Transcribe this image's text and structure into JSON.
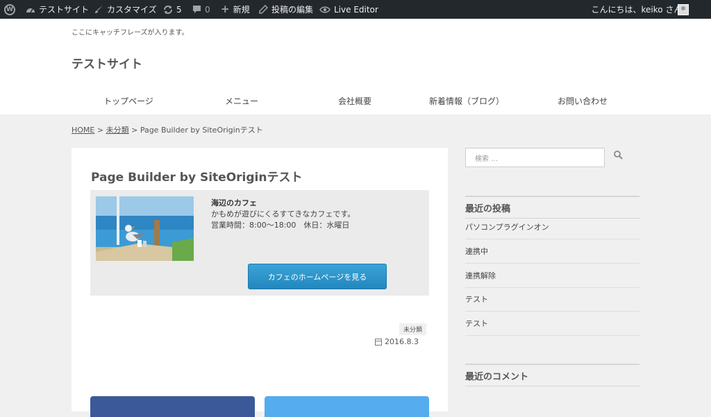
{
  "admin_bar": {
    "wp_logo": "wordpress-icon",
    "site_name": "テストサイト",
    "customize": "カスタマイズ",
    "updates_count": "5",
    "comments_count": "0",
    "new_label": "新規",
    "edit_post": "投稿の編集",
    "live_editor": "Live Editor",
    "greeting": "こんにちは、keiko さん !"
  },
  "header": {
    "tagline": "ここにキャッチフレーズが入ります。",
    "site_title": "テストサイト"
  },
  "nav": {
    "items": [
      "トップページ",
      "メニュー",
      "会社概要",
      "新着情報（ブログ）",
      "お問い合わせ"
    ]
  },
  "breadcrumb": {
    "home": "HOME",
    "sep": ">",
    "category": "未分類",
    "current": "Page Builder by SiteOriginテスト"
  },
  "article": {
    "title": "Page Builder by SiteOriginテスト",
    "widget": {
      "title": "海辺のカフェ",
      "line1": "かもめが遊びにくるすてきなカフェです。",
      "line2": "営業時間：8:00〜18:00　休日：水曜日",
      "button": "カフェのホームページを見る"
    },
    "category": "未分類",
    "date": "2016.8.3"
  },
  "sidebar": {
    "search_placeholder": "検索 …",
    "recent_posts_heading": "最近の投稿",
    "recent_posts": [
      "パソコンプラグインオン",
      "連携中",
      "連携解除",
      "テスト",
      "テスト"
    ],
    "recent_comments_heading": "最近のコメント"
  },
  "colors": {
    "admin_bar_bg": "#23282d",
    "button_blue": "#2b95cf",
    "facebook_blue": "#3b5998",
    "twitter_blue": "#55acee"
  }
}
